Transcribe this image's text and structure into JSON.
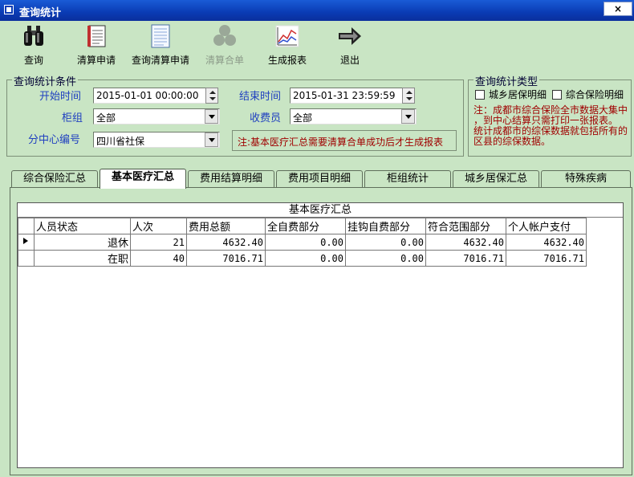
{
  "window": {
    "title": "查询统计",
    "close_glyph": "×"
  },
  "toolbar": {
    "query": "查询",
    "settle_apply": "清算申请",
    "query_settle_apply": "查询清算申请",
    "settle_merge": "清算合单",
    "gen_report": "生成报表",
    "exit": "退出"
  },
  "conditions": {
    "legend": "查询统计条件",
    "start_label": "开始时间",
    "start_value": "2015-01-01 00:00:00",
    "end_label": "结束时间",
    "end_value": "2015-01-31 23:59:59",
    "counter_label": "柜组",
    "counter_value": "全部",
    "cashier_label": "收费员",
    "cashier_value": "全部",
    "center_label": "分中心编号",
    "center_value": "四川省社保",
    "note": "注:基本医疗汇总需要清算合单成功后才生成报表"
  },
  "stat_type": {
    "legend": "查询统计类型",
    "opt1": "城乡居保明细",
    "opt2": "综合保险明细",
    "note_lines": [
      "注：成都市综合保险全市数据大集中",
      "，到中心结算只需打印一张报表。",
      "统计成都市的综保数据就包括所有的",
      "区县的综保数据。"
    ]
  },
  "tabs": [
    "综合保险汇总",
    "基本医疗汇总",
    "费用结算明细",
    "费用项目明细",
    "柜组统计",
    "城乡居保汇总",
    "特殊疾病"
  ],
  "grid": {
    "caption": "基本医疗汇总",
    "columns": [
      "人员状态",
      "人次",
      "费用总额",
      "全自费部分",
      "挂钩自费部分",
      "符合范围部分",
      "个人帐户支付"
    ],
    "rows": [
      [
        "退休",
        "21",
        "4632.40",
        "0.00",
        "0.00",
        "4632.40",
        "4632.40"
      ],
      [
        "在职",
        "40",
        "7016.71",
        "0.00",
        "0.00",
        "7016.71",
        "7016.71"
      ]
    ]
  },
  "colors": {
    "background": "#c9e5c4",
    "title_bar": "#0a3bb4",
    "label_blue": "#2040c0",
    "note_red": "#a00000"
  }
}
